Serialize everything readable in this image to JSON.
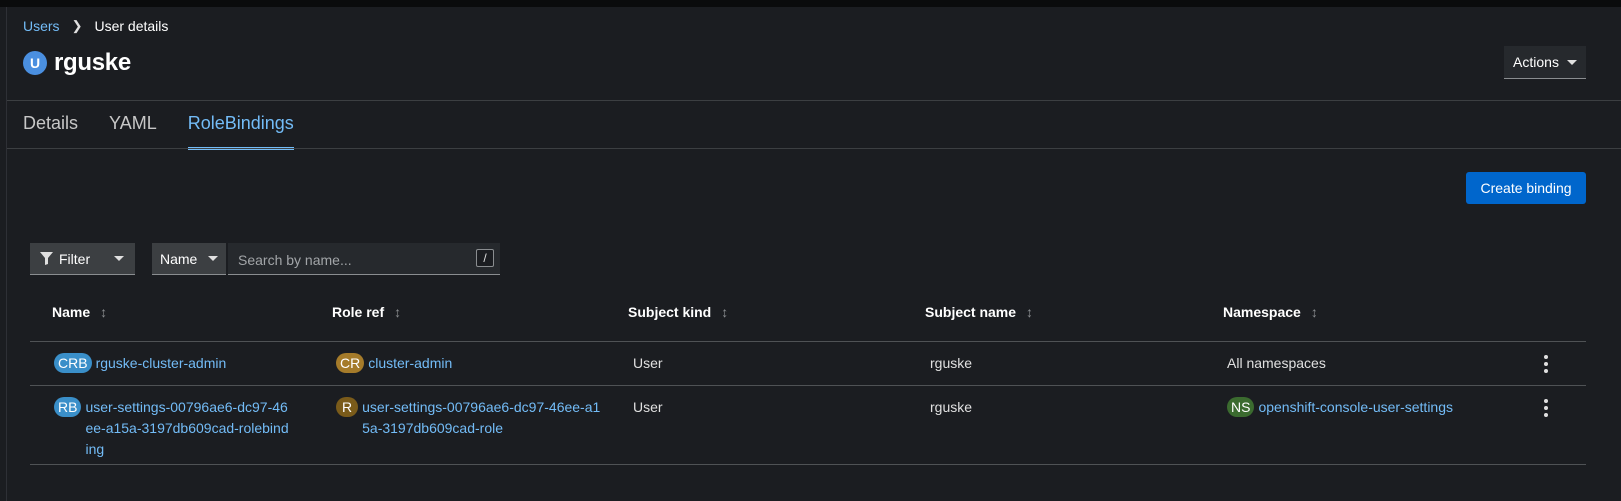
{
  "breadcrumb": {
    "parent": "Users",
    "current": "User details"
  },
  "header": {
    "badge": "U",
    "title": "rguske",
    "actions_label": "Actions"
  },
  "tabs": [
    {
      "label": "Details"
    },
    {
      "label": "YAML"
    },
    {
      "label": "RoleBindings",
      "active": true
    }
  ],
  "toolbar": {
    "create_label": "Create binding",
    "filter_label": "Filter",
    "name_select": "Name",
    "search_placeholder": "Search by name...",
    "search_shortcut": "/"
  },
  "table": {
    "columns": [
      "Name",
      "Role ref",
      "Subject kind",
      "Subject name",
      "Namespace"
    ],
    "rows": [
      {
        "name_badge": "CRB",
        "name": "rguske-cluster-admin",
        "role_badge": "CR",
        "role": "cluster-admin",
        "subject_kind": "User",
        "subject_name": "rguske",
        "namespace_badge": "",
        "namespace": "All namespaces"
      },
      {
        "name_badge": "RB",
        "name": "user-settings-00796ae6-dc97-46ee-a15a-3197db609cad-rolebinding",
        "role_badge": "R",
        "role": "user-settings-00796ae6-dc97-46ee-a15a-3197db609cad-role",
        "subject_kind": "User",
        "subject_name": "rguske",
        "namespace_badge": "NS",
        "namespace": "openshift-console-user-settings"
      }
    ]
  },
  "colors": {
    "link": "#73bcf7",
    "primary_button": "#0066cc",
    "background": "#1b1d21"
  }
}
